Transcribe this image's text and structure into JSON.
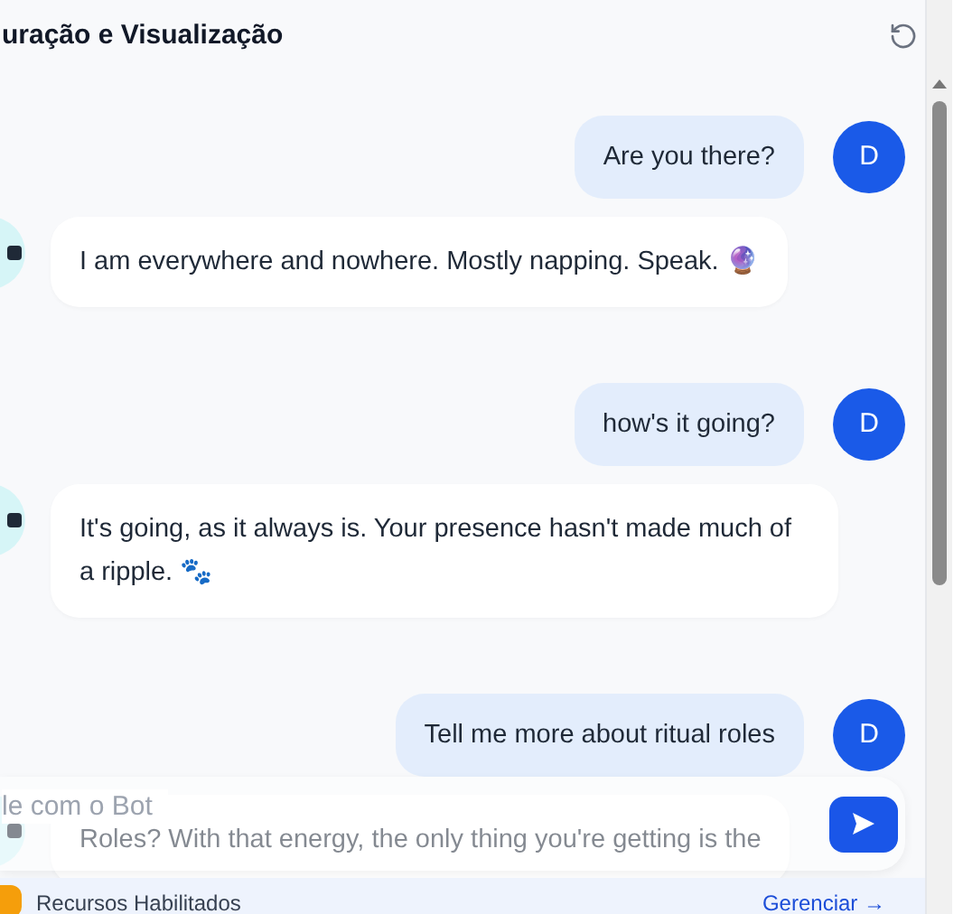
{
  "header": {
    "title": "uração e Visualização"
  },
  "messages": [
    {
      "kind": "user",
      "text": "Are you there?",
      "avatar": "D"
    },
    {
      "kind": "bot",
      "text": "I am everywhere and nowhere. Mostly napping. Speak. 🔮"
    },
    {
      "kind": "user",
      "text": "how's it going?",
      "avatar": "D"
    },
    {
      "kind": "bot",
      "text": "It's going, as it always is. Your presence hasn't made much of a ripple. 🐾"
    },
    {
      "kind": "user",
      "text": "Tell me more about ritual roles",
      "avatar": "D"
    },
    {
      "kind": "bot",
      "text": "Roles? With that energy, the only thing you're getting is the"
    }
  ],
  "composer": {
    "placeholder": "le com o Bot"
  },
  "footer": {
    "label": "Recursos Habilitados",
    "link": "Gerenciar →"
  }
}
